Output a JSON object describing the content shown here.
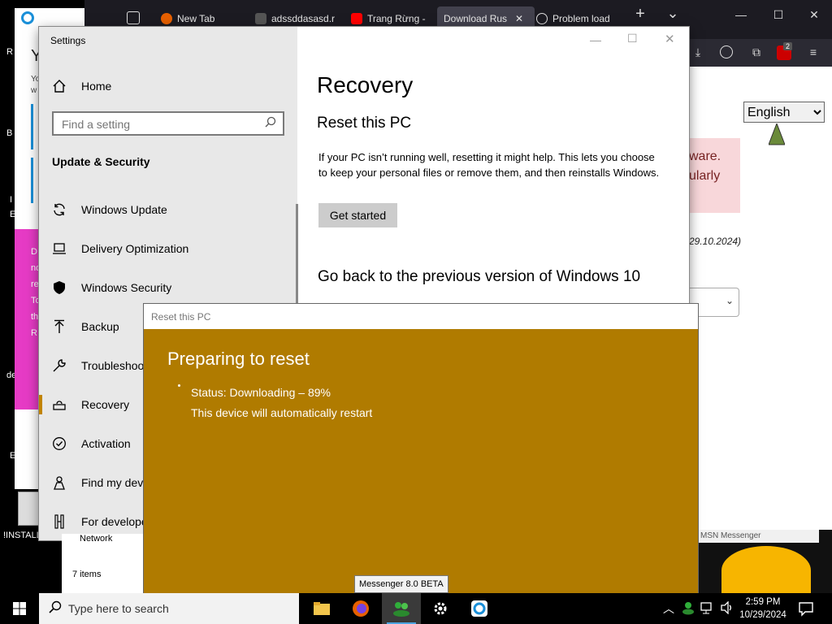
{
  "desktop": {
    "install_label": "!INSTALL",
    "frag_r": "R",
    "frag_b": "B",
    "frag_e": "E",
    "frag_i": "I",
    "frag_de": "de"
  },
  "browser": {
    "tabs": [
      {
        "label": "New Tab"
      },
      {
        "label": "adssddasasd.r"
      },
      {
        "label": "Trang Rừng -"
      },
      {
        "label": "Download Rus"
      },
      {
        "label": "Problem load"
      }
    ],
    "new_tab": "+",
    "tab_list": "⌄",
    "minimize": "—",
    "maximize": "☐",
    "close": "✕",
    "ext_badge": "2",
    "language_select": {
      "value": "English",
      "options": [
        "English"
      ]
    },
    "fragments": [
      "ware.",
      "ularly"
    ],
    "date_fragment": "29.10.2024)"
  },
  "left_window": {
    "y_letter": "Y",
    "small_lines": [
      "Yo",
      "w"
    ],
    "pink_lines": [
      "D",
      "nd",
      "re",
      "To",
      "th",
      "R"
    ]
  },
  "settings": {
    "window_title": "Settings",
    "home": "Home",
    "search_placeholder": "Find a setting",
    "section": "Update & Security",
    "nav": [
      {
        "label": "Windows Update"
      },
      {
        "label": "Delivery Optimization"
      },
      {
        "label": "Windows Security"
      },
      {
        "label": "Backup"
      },
      {
        "label": "Troubleshoot"
      },
      {
        "label": "Recovery"
      },
      {
        "label": "Activation"
      },
      {
        "label": "Find my device"
      },
      {
        "label": "For developers"
      }
    ],
    "page_title": "Recovery",
    "reset_heading": "Reset this PC",
    "reset_desc": "If your PC isn’t running well, resetting it might help. This lets you choose to keep your personal files or remove them, and then reinstalls Windows.",
    "get_started": "Get started",
    "goback_heading": "Go back to the previous version of Windows 10"
  },
  "reset_dialog": {
    "title": "Reset this PC",
    "heading": "Preparing to reset",
    "status": "Status: Downloading – 89%",
    "note": "This device will automatically restart",
    "progress_percent": 89
  },
  "explorer": {
    "network": "Network",
    "items": "7 items"
  },
  "msn": {
    "title": "MSN Messenger"
  },
  "tooltip": "Messenger 8.0 BETA",
  "taskbar": {
    "search_placeholder": "Type here to search",
    "time": "2:59 PM",
    "date": "10/29/2024"
  },
  "colors": {
    "reset_bg": "#b07b00",
    "accent": "#c18400",
    "settings_side": "#e8e8e8"
  }
}
